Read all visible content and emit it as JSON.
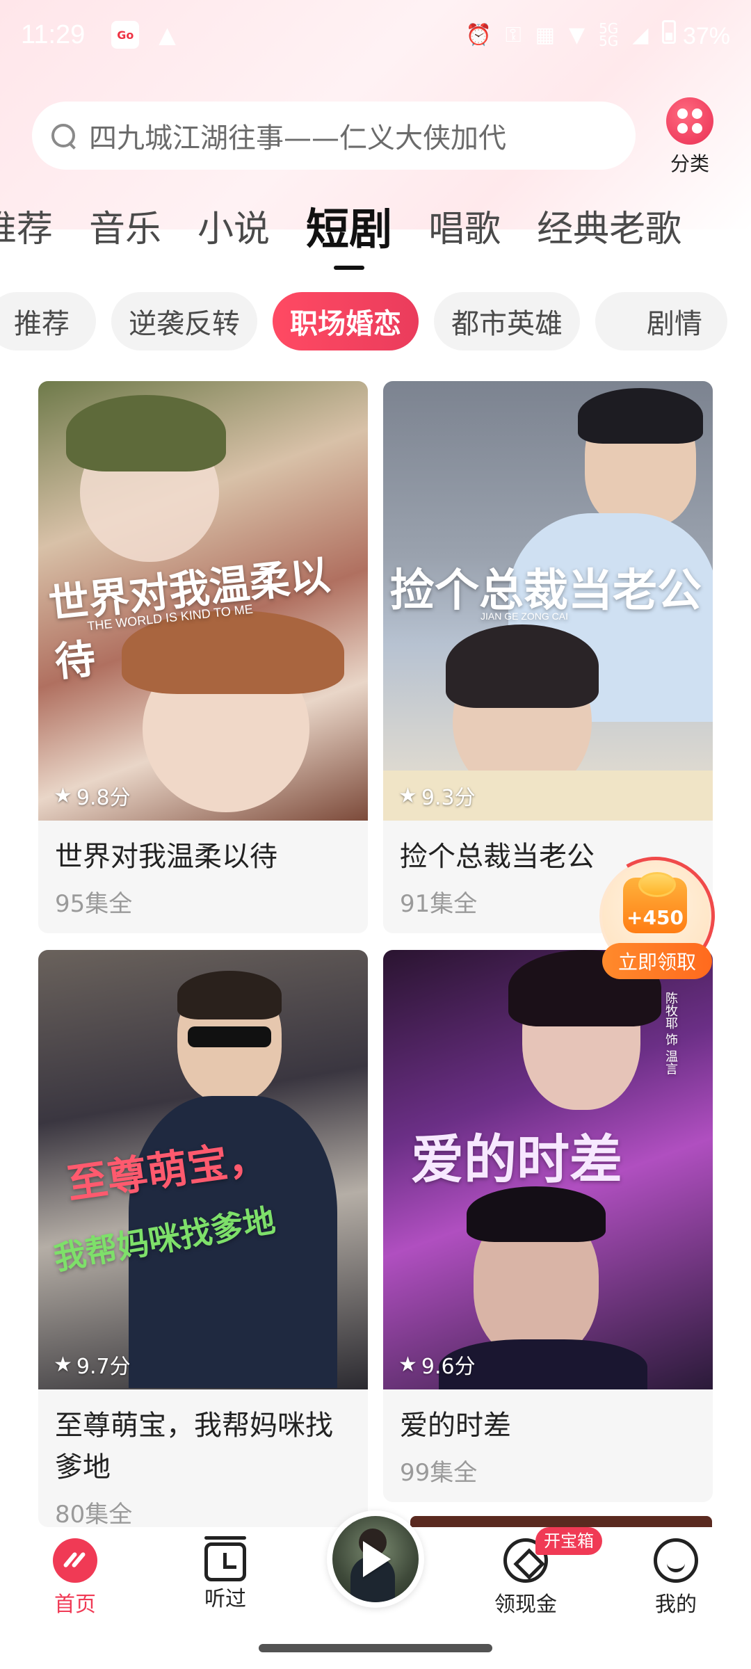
{
  "status_bar": {
    "time": "11:29",
    "battery": "37%",
    "signal_labels": [
      "5G",
      "5G"
    ]
  },
  "search": {
    "placeholder": "四九城江湖往事——仁义大侠加代"
  },
  "category": {
    "label": "分类"
  },
  "main_tabs": [
    {
      "label": "推荐"
    },
    {
      "label": "音乐"
    },
    {
      "label": "小说"
    },
    {
      "label": "短剧",
      "active": true
    },
    {
      "label": "唱歌"
    },
    {
      "label": "经典老歌"
    }
  ],
  "sub_tabs": [
    {
      "label": "推荐"
    },
    {
      "label": "逆袭反转"
    },
    {
      "label": "职场婚恋",
      "active": true
    },
    {
      "label": "都市英雄"
    },
    {
      "label": "剧情"
    }
  ],
  "cards": [
    {
      "title": "世界对我温柔以待",
      "poster_text": "世界对我温柔以待",
      "poster_sub": "THE WORLD IS KIND TO ME",
      "rating": "9.8分",
      "episodes": "95集全",
      "colors": [
        "#e8c9b8",
        "#b06a52",
        "#8b4a3a"
      ]
    },
    {
      "title": "捡个总裁当老公",
      "poster_text": "捡个总裁当老公",
      "poster_sub": "JIAN GE ZONG CAI",
      "rating": "9.3分",
      "episodes": "91集全",
      "colors": [
        "#9aa2ae",
        "#c9d3e0",
        "#ece2cf"
      ]
    },
    {
      "title": "至尊萌宝，我帮妈咪找爹地",
      "poster_text": "至尊萌宝，",
      "poster_sub": "我帮妈咪找爹地",
      "rating": "9.7分",
      "episodes": "80集全",
      "colors": [
        "#5a5250",
        "#2c2a33",
        "#a5a09a"
      ]
    },
    {
      "title": "爱的时差",
      "poster_text": "爱的时差",
      "poster_sub": "陈牧耶 饰 温言",
      "rating": "9.6分",
      "episodes": "99集全",
      "colors": [
        "#3a1c4a",
        "#8a3fa0",
        "#241630"
      ]
    }
  ],
  "reward": {
    "amount": "+450",
    "button": "立即领取"
  },
  "bottom_nav": {
    "home": "首页",
    "history": "听过",
    "earn": "领现金",
    "earn_badge": "开宝箱",
    "me": "我的"
  }
}
